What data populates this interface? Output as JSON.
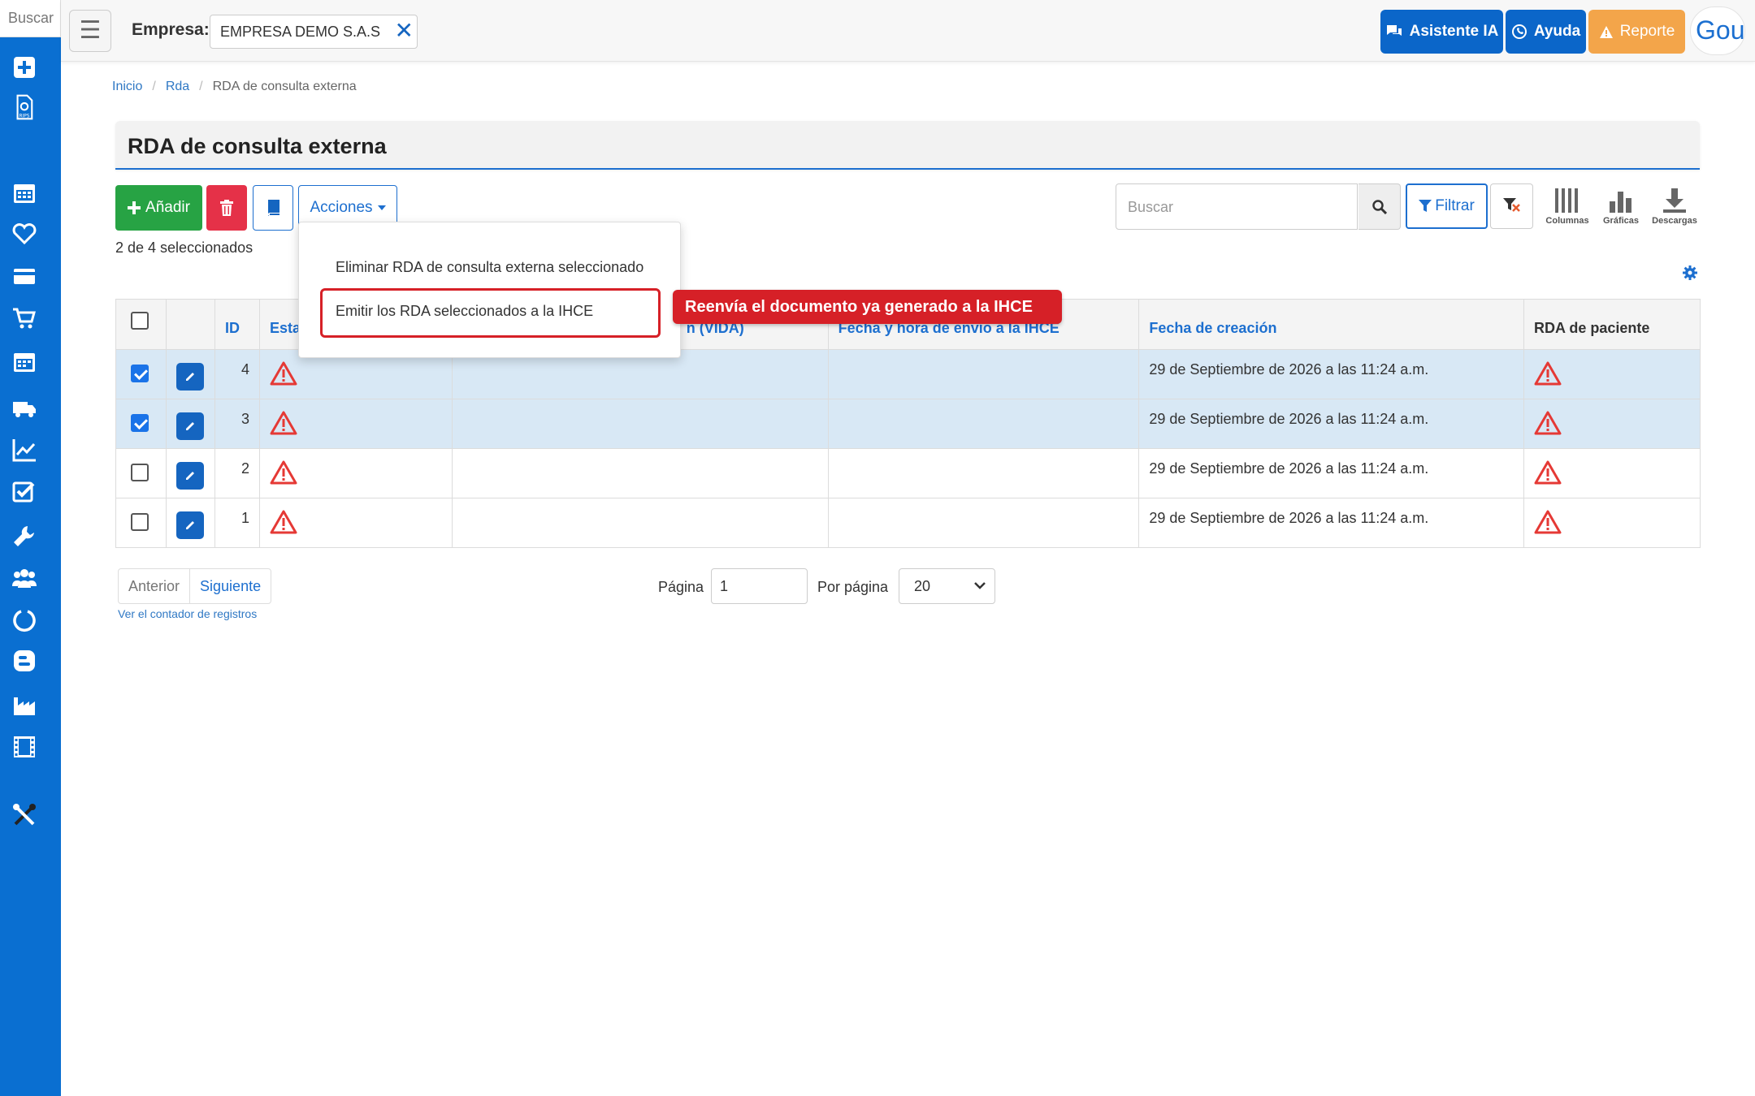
{
  "sidebar": {
    "search_placeholder": "Buscar",
    "icons": [
      "plus-square-icon",
      "rips-icon",
      "calendar-icon",
      "heart-icon",
      "credit-card-icon",
      "cart-icon",
      "calendar-alt-icon",
      "truck-icon",
      "chart-line-icon",
      "checklist-icon",
      "wrench-icon",
      "users-icon",
      "circle-notch-icon",
      "blog-icon",
      "industry-icon",
      "film-icon",
      "tools-icon"
    ]
  },
  "topbar": {
    "empresa_label": "Empresa:",
    "empresa_value": "EMPRESA DEMO S.A.S",
    "asistente_label": "Asistente IA",
    "ayuda_label": "Ayuda",
    "reporte_label": "Reporte",
    "avatar_text": "Gou"
  },
  "breadcrumb": {
    "home": "Inicio",
    "section": "Rda",
    "current": "RDA de consulta externa"
  },
  "page_title": "RDA de consulta externa",
  "toolbar": {
    "add_label": "Añadir",
    "acciones_label": "Acciones",
    "selection_text": "2 de 4 seleccionados",
    "search_placeholder": "Buscar",
    "filtrar_label": "Filtrar",
    "columnas_label": "Columnas",
    "graficas_label": "Gráficas",
    "descargas_label": "Descargas"
  },
  "dropdown": {
    "item_1": "Eliminar RDA de consulta externa seleccionado",
    "item_2": "Emitir los RDA seleccionados a la IHCE"
  },
  "tooltip": "Reenvía el documento ya generado a la IHCE",
  "table": {
    "headers": {
      "id": "ID",
      "estado": "Esta",
      "vida": "n (VIDA)",
      "fecha_envio": "Fecha y hora de envío a la IHCE",
      "fecha_creacion": "Fecha de creación",
      "rda_paciente": "RDA de paciente"
    },
    "rows": [
      {
        "selected": true,
        "id": "4",
        "fecha_creacion": "29 de Septiembre de 2026 a las 11:24 a.m."
      },
      {
        "selected": true,
        "id": "3",
        "fecha_creacion": "29 de Septiembre de 2026 a las 11:24 a.m."
      },
      {
        "selected": false,
        "id": "2",
        "fecha_creacion": "29 de Septiembre de 2026 a las 11:24 a.m."
      },
      {
        "selected": false,
        "id": "1",
        "fecha_creacion": "29 de Septiembre de 2026 a las 11:24 a.m."
      }
    ]
  },
  "pagination": {
    "prev_label": "Anterior",
    "next_label": "Siguiente",
    "contador_link": "Ver el contador de registros",
    "page_label": "Página",
    "page_value": "1",
    "per_page_label": "Por página",
    "per_page_value": "20"
  },
  "colors": {
    "primary": "#0a6fd1",
    "success": "#27a344",
    "danger": "#e53148",
    "warning": "#f3a54a",
    "highlight": "#d62027",
    "selected_row": "#d8e8f5"
  }
}
